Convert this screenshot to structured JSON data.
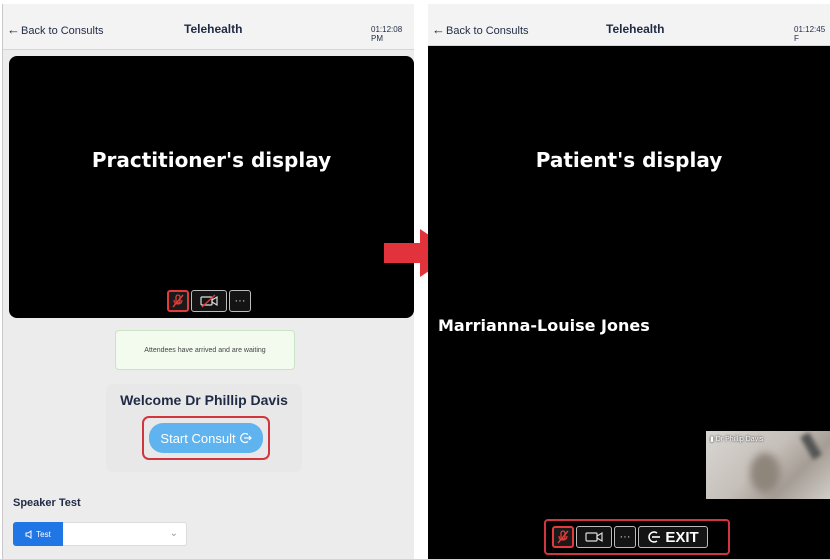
{
  "practitioner": {
    "back_label": "Back to Consults",
    "title": "Telehealth",
    "time": "01:12:08 PM",
    "display_caption": "Practitioner's display",
    "waiting_notice": "Attendees have arrived and are waiting",
    "welcome": "Welcome Dr Phillip Davis",
    "start_button": "Start Consult",
    "speaker_test_title": "Speaker Test",
    "test_button": "Test",
    "speaker_select_value": ""
  },
  "patient": {
    "back_label": "Back to Consults",
    "title": "Telehealth",
    "time": "01:12:45 F",
    "display_caption": "Patient's display",
    "participant_name": "Marrianna-Louise Jones",
    "pip_label": "Dr Phillip Davis",
    "exit_button": "EXIT"
  },
  "controls": {
    "more_label": "···"
  },
  "colors": {
    "highlight": "#d1353f",
    "arrow": "#e2323c",
    "start_button": "#5fb3ee",
    "test_button": "#2176e6",
    "mic_muted": "#e23b3b"
  },
  "icons": [
    "back-arrow-icon",
    "mic-muted-icon",
    "camera-off-icon",
    "camera-icon",
    "more-icon",
    "exit-icon",
    "start-icon",
    "speaker-icon",
    "chevron-down-icon",
    "signal-icon"
  ]
}
